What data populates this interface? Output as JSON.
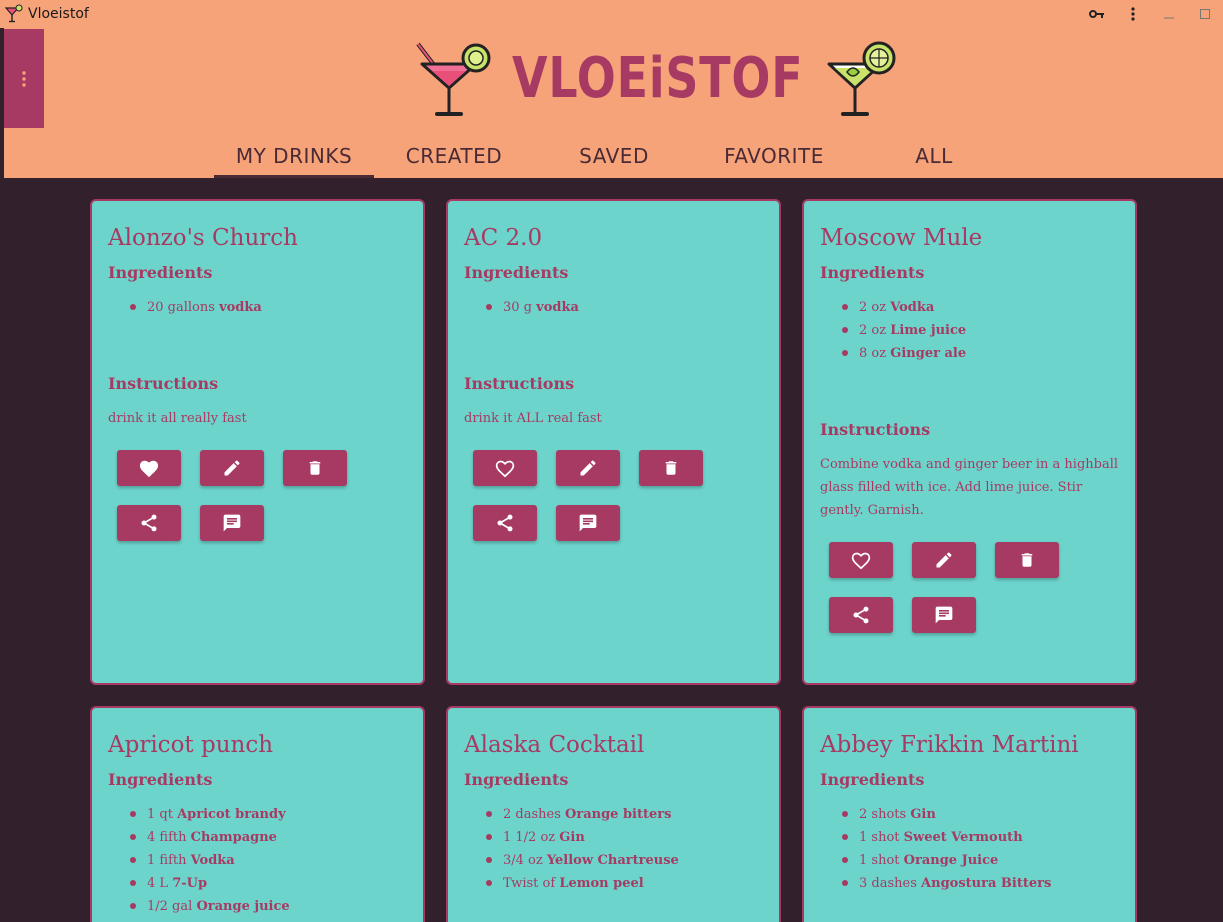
{
  "window": {
    "title": "Vloeistof"
  },
  "header": {
    "logo_text": "VLOEiSTOF"
  },
  "tabs": [
    {
      "label": "MY DRINKS",
      "active": true
    },
    {
      "label": "CREATED",
      "active": false
    },
    {
      "label": "SAVED",
      "active": false
    },
    {
      "label": "FAVORITE",
      "active": false
    },
    {
      "label": "ALL",
      "active": false
    }
  ],
  "labels": {
    "ingredients": "Ingredients",
    "instructions": "Instructions"
  },
  "drinks": [
    {
      "name": "Alonzo's Church",
      "ingredients": [
        {
          "qty": "20 gallons",
          "item": "vodka"
        }
      ],
      "instructions": "drink it all really fast",
      "favorite": true
    },
    {
      "name": "AC 2.0",
      "ingredients": [
        {
          "qty": "30 g",
          "item": "vodka"
        }
      ],
      "instructions": "drink it ALL real fast",
      "favorite": false
    },
    {
      "name": "Moscow Mule",
      "ingredients": [
        {
          "qty": "2 oz",
          "item": "Vodka"
        },
        {
          "qty": "2 oz",
          "item": "Lime juice"
        },
        {
          "qty": "8 oz",
          "item": "Ginger ale"
        }
      ],
      "instructions": "Combine vodka and ginger beer in a highball glass filled with ice. Add lime juice. Stir gently. Garnish.",
      "favorite": false
    },
    {
      "name": "Apricot punch",
      "ingredients": [
        {
          "qty": "1 qt",
          "item": "Apricot brandy"
        },
        {
          "qty": "4 fifth",
          "item": "Champagne"
        },
        {
          "qty": "1 fifth",
          "item": "Vodka"
        },
        {
          "qty": "4 L",
          "item": "7-Up"
        },
        {
          "qty": "1/2 gal",
          "item": "Orange juice"
        }
      ]
    },
    {
      "name": "Alaska Cocktail",
      "ingredients": [
        {
          "qty": "2 dashes",
          "item": "Orange bitters"
        },
        {
          "qty": "1 1/2 oz",
          "item": "Gin"
        },
        {
          "qty": "3/4 oz",
          "item": "Yellow Chartreuse"
        },
        {
          "qty": "Twist of",
          "item": "Lemon peel"
        }
      ]
    },
    {
      "name": "Abbey Frikkin Martini",
      "ingredients": [
        {
          "qty": "2 shots",
          "item": "Gin"
        },
        {
          "qty": "1 shot",
          "item": "Sweet Vermouth"
        },
        {
          "qty": "1 shot",
          "item": "Orange Juice"
        },
        {
          "qty": "3 dashes",
          "item": "Angostura Bitters"
        }
      ]
    }
  ],
  "colors": {
    "header_bg": "#f7a37a",
    "accent": "#a73a62",
    "card_bg": "#6dd4cc",
    "page_bg": "#33202d"
  },
  "icons": [
    "cocktail-icon",
    "key-icon",
    "more-vert-icon",
    "minimize-icon",
    "maximize-icon",
    "heart-icon",
    "pencil-icon",
    "trash-icon",
    "share-icon",
    "comment-icon"
  ]
}
